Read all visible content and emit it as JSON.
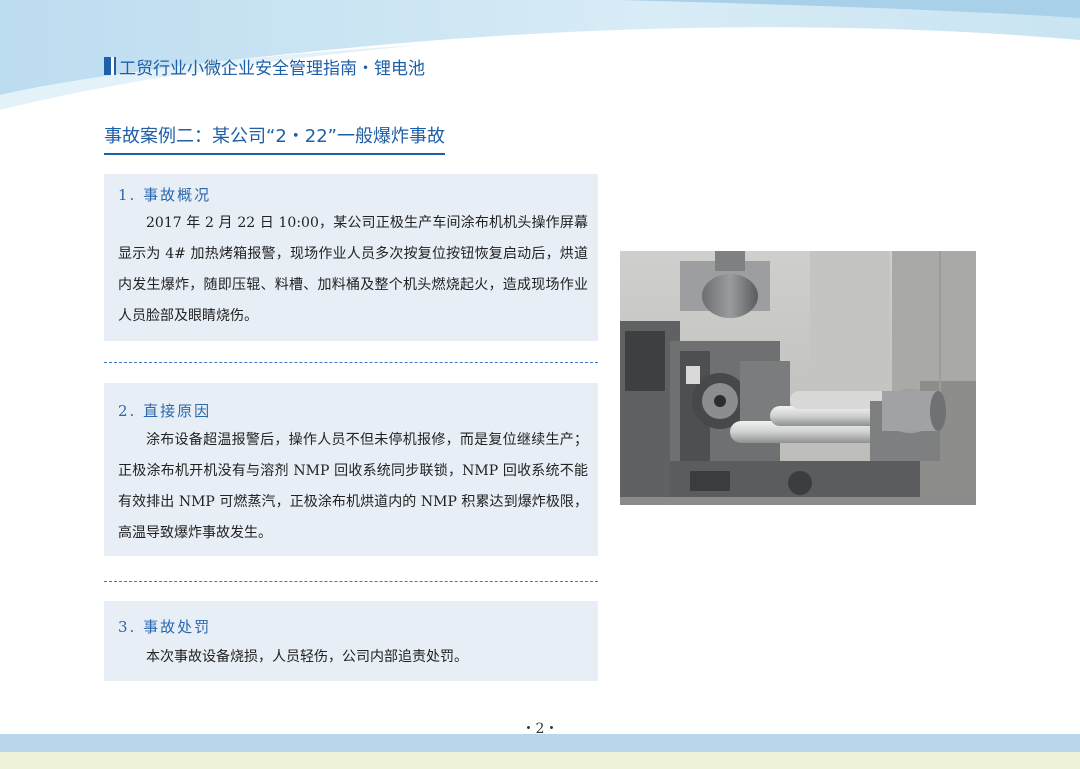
{
  "header": {
    "title": "工贸行业小微企业安全管理指南・锂电池"
  },
  "page_title": "事故案例二：某公司“2・22”一般爆炸事故",
  "sections": [
    {
      "title": "1. 事故概况",
      "body": "2017 年 2 月 22 日 10:00，某公司正极生产车间涂布机机头操作屏幕显示为 4# 加热烤箱报警，现场作业人员多次按复位按钮恢复启动后，烘道内发生爆炸，随即压辊、料槽、加料桶及整个机头燃烧起火，造成现场作业人员脸部及眼睛烧伤。"
    },
    {
      "title": "2. 直接原因",
      "body": "涂布设备超温报警后，操作人员不但未停机报修，而是复位继续生产；正极涂布机开机没有与溶剂 NMP 回收系统同步联锁，NMP 回收系统不能有效排出 NMP 可燃蒸汽，正极涂布机烘道内的 NMP 积累达到爆炸极限，高温导致爆炸事故发生。"
    },
    {
      "title": "3. 事故处罚",
      "body": "本次事故设备烧损，人员轻伤，公司内部追责处罚。"
    }
  ],
  "page_number": "・2・",
  "colors": {
    "accent": "#1f5fa8",
    "section_bg": "#e8eef5",
    "footer_band": "#b8d7ea"
  }
}
